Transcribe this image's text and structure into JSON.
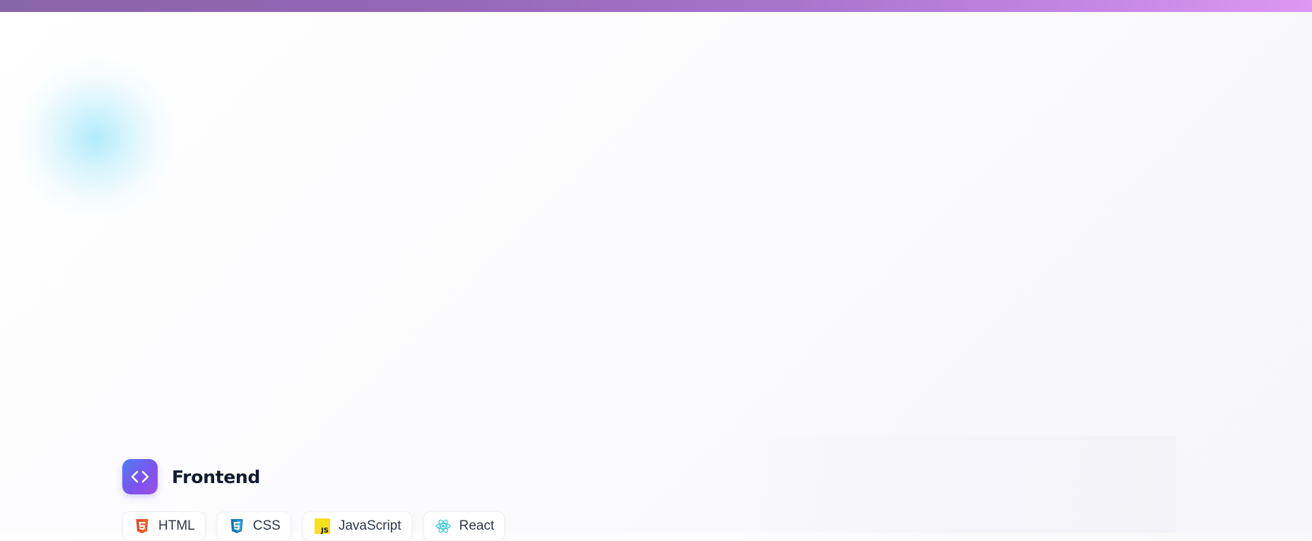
{
  "colors": {
    "top_bar_start": "#8a64a8",
    "top_bar_end": "#dc98f2",
    "section_icon_start": "#4f7cf5",
    "section_icon_end": "#9b4ee6",
    "title": "#121a2e",
    "chip_text": "#2f3747"
  },
  "section": {
    "title": "Frontend",
    "icon": "code-brackets-icon",
    "skills": [
      {
        "label": "HTML",
        "icon": "html5-icon",
        "color": "#e44d26"
      },
      {
        "label": "CSS",
        "icon": "css3-icon",
        "color": "#1572b6"
      },
      {
        "label": "JavaScript",
        "icon": "javascript-icon",
        "color": "#f7df1e"
      },
      {
        "label": "React",
        "icon": "react-icon",
        "color": "#61dafb"
      }
    ]
  }
}
